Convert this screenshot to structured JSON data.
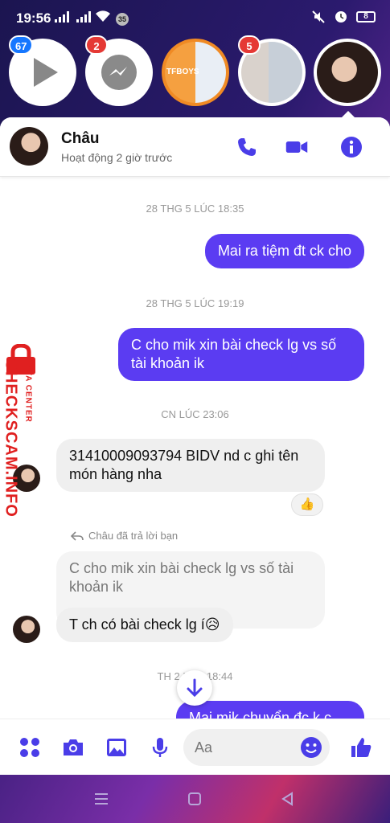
{
  "status_bar": {
    "time": "19:56",
    "notif_count": "35",
    "battery": "8"
  },
  "chat_heads": [
    {
      "name": "video-head",
      "badge": "67",
      "badge_color": "blue"
    },
    {
      "name": "messenger-head",
      "badge": "2",
      "badge_color": "red"
    },
    {
      "name": "group-head-tfboys",
      "badge": "",
      "caption": "TFBOYS"
    },
    {
      "name": "group-head-anime",
      "badge": "5",
      "badge_color": "red"
    },
    {
      "name": "chau-head",
      "badge": ""
    }
  ],
  "header": {
    "name": "Châu",
    "status": "Hoạt động 2 giờ trước"
  },
  "messages": {
    "ts1": "28 THG 5 LÚC 18:35",
    "m1": "Mai ra tiệm đt ck cho",
    "ts2": "28 THG 5 LÚC 19:19",
    "m2": "C cho mik xin bài check lg vs số tài khoản ik",
    "ts3": "CN LÚC 23:06",
    "m3": "31410009093794 BIDV nd c ghi tên món hàng nha",
    "m3_reaction": "👍",
    "reply_label": "Châu đã trả lời bạn",
    "quoted": "C cho mik xin bài check lg vs số tài khoản ik",
    "m4": "T ch có bài check lg í😥",
    "ts4": "TH 2 LÚC 18:44",
    "m5": "Mai mik chuyển đc k c"
  },
  "composer": {
    "placeholder": "Aa"
  },
  "watermark": {
    "line1": "CHECKSCAM.INFO",
    "line2": "DATA CENTER"
  },
  "colors": {
    "accent": "#5b3cf2",
    "icon_blue": "#1a73e8",
    "watermark_red": "#e02020"
  }
}
